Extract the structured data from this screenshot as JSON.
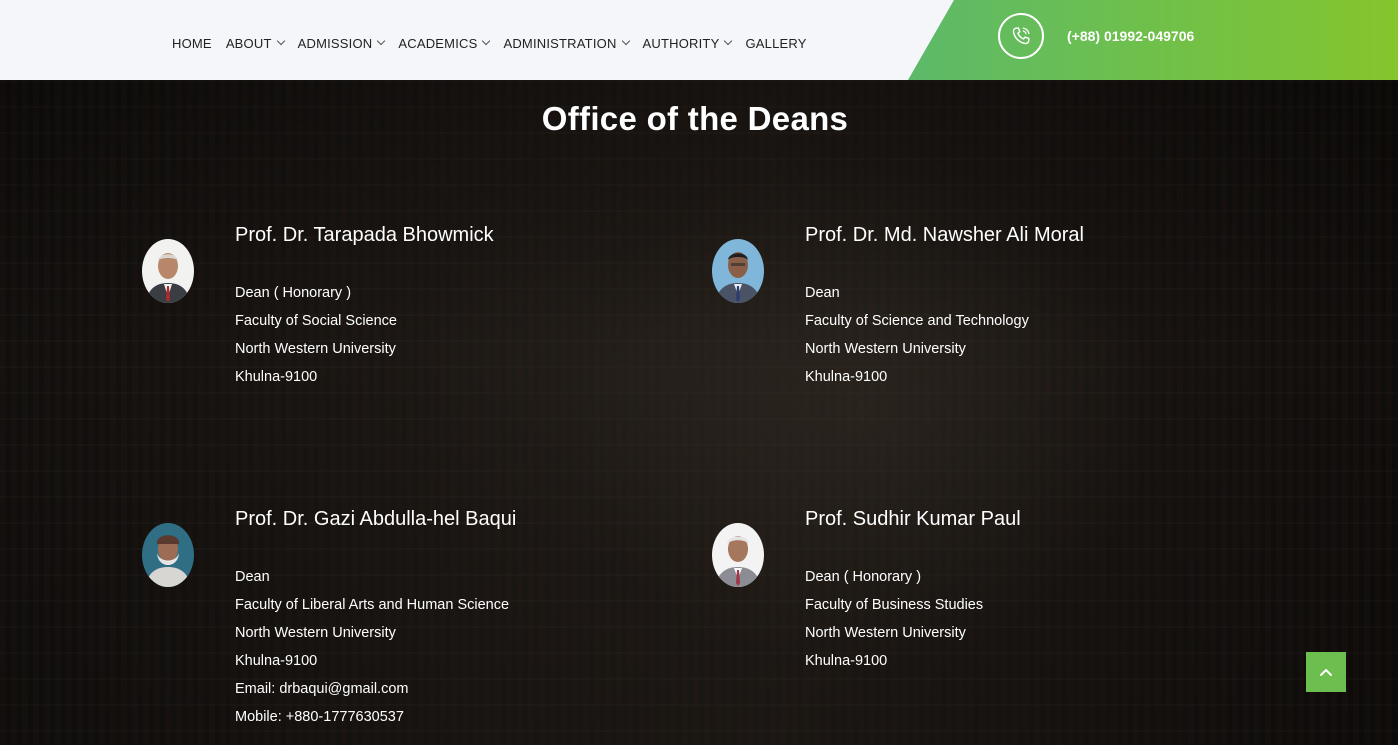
{
  "header": {
    "nav": [
      {
        "label": "HOME",
        "dropdown": false
      },
      {
        "label": "ABOUT",
        "dropdown": true
      },
      {
        "label": "ADMISSION",
        "dropdown": true
      },
      {
        "label": "ACADEMICS",
        "dropdown": true
      },
      {
        "label": "ADMINISTRATION",
        "dropdown": true
      },
      {
        "label": "AUTHORITY",
        "dropdown": true
      },
      {
        "label": "GALLERY",
        "dropdown": false
      }
    ],
    "phone": "(+88) 01992-049706",
    "phone_icon": "phone-icon",
    "accent_color": "#74c13f"
  },
  "page": {
    "title": "Office of the Deans"
  },
  "deans": [
    {
      "name": "Prof. Dr. Tarapada Bhowmick",
      "lines": [
        "Dean ( Honorary )",
        "Faculty of Social Science",
        "North Western University",
        "Khulna-9100"
      ]
    },
    {
      "name": "Prof. Dr. Md. Nawsher Ali Moral",
      "lines": [
        "Dean",
        "Faculty of Science and Technology",
        "North Western University",
        "Khulna-9100"
      ]
    },
    {
      "name": "Prof. Dr. Gazi Abdulla-hel Baqui",
      "lines": [
        "Dean",
        "Faculty of Liberal Arts and Human Science",
        "North Western University",
        "Khulna-9100",
        "Email: drbaqui@gmail.com",
        "Mobile: +880-1777630537"
      ]
    },
    {
      "name": "Prof. Sudhir Kumar Paul",
      "lines": [
        "Dean ( Honorary )",
        "Faculty of Business Studies",
        "North Western University",
        "Khulna-9100"
      ]
    }
  ],
  "scroll_top_icon": "chevron-up-icon"
}
